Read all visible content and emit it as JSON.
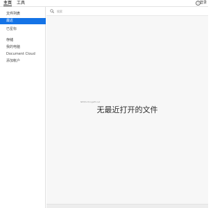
{
  "topbar": {
    "tabs": [
      {
        "label": "主页",
        "active": true
      },
      {
        "label": "工具",
        "active": false
      }
    ],
    "help_icon": "help-icon",
    "help_glyph": "?",
    "login_label": "登录"
  },
  "sidebar": {
    "sections": [
      {
        "heading": "文件列表",
        "items": [
          {
            "label": "最近",
            "active": true
          },
          {
            "label": "已星标",
            "active": false
          }
        ]
      },
      {
        "heading": "存储",
        "items": [
          {
            "label": "我的电脑",
            "active": false
          },
          {
            "label": "Document Cloud",
            "active": false
          },
          {
            "label": "添加帐户",
            "active": false
          }
        ]
      }
    ],
    "active_color": "#1473e6"
  },
  "search": {
    "icon": "search-icon",
    "placeholder": "搜索",
    "value": ""
  },
  "main": {
    "empty_title": "无最近打开的文件",
    "watermark": "NEWS.thingsfit.net"
  }
}
